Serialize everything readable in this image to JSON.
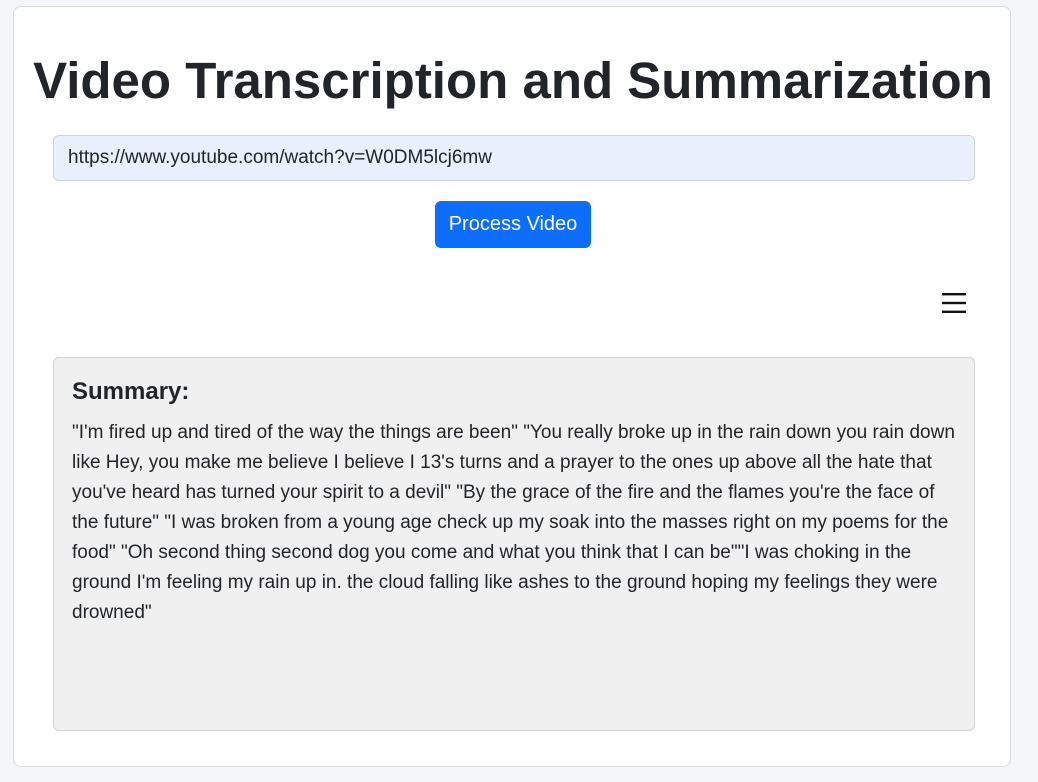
{
  "page": {
    "title": "Video Transcription and Summarization"
  },
  "form": {
    "url_value": "https://www.youtube.com/watch?v=W0DM5lcj6mw",
    "process_button_label": "Process Video"
  },
  "menu": {
    "icon": "hamburger-menu-icon",
    "glyph": "☰"
  },
  "summary": {
    "heading": "Summary:",
    "text": "\"I'm fired up and tired of the way the things are been\" \"You really broke up in the rain down you rain down like Hey, you make me believe I believe I 13's turns and a prayer to the ones up above all the hate that you've heard has turned your spirit to a devil\" \"By the grace of the fire and the flames you're the face of the future\" \"I was broken from a young age check up my soak into the masses right on my poems for the food\" \"Oh second thing second dog you come and what you think that I can be\"\"I was choking in the ground I'm feeling my rain up in. the cloud falling like ashes to the ground hoping my feelings they were drowned\""
  },
  "colors": {
    "accent": "#0d6efd",
    "input_background": "#e8f0fe",
    "summary_background": "#f0f0f0"
  }
}
